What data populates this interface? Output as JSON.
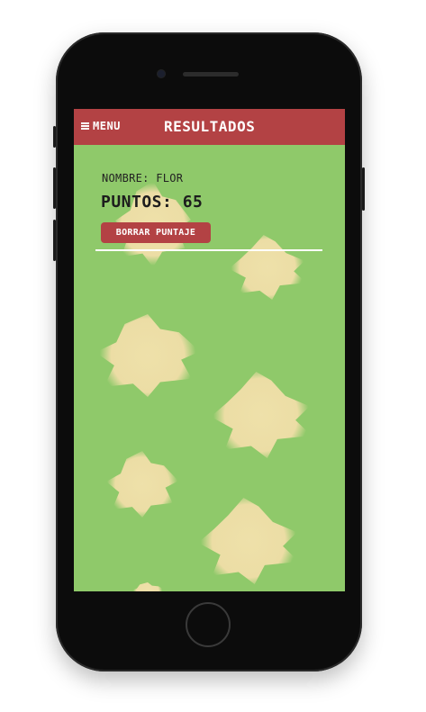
{
  "header": {
    "menu_label": "MENU",
    "title": "RESULTADOS"
  },
  "result": {
    "name_text": "NOMBRE: FLOR",
    "points_text": "PUNTOS: 65"
  },
  "actions": {
    "clear_label": "BORRAR PUNTAJE"
  },
  "colors": {
    "header_bg": "#b34244",
    "screen_bg": "#8fc96a",
    "blob": "#f1dea8",
    "button_bg": "#b34244"
  },
  "icons": {
    "menu": "hamburger-icon"
  }
}
